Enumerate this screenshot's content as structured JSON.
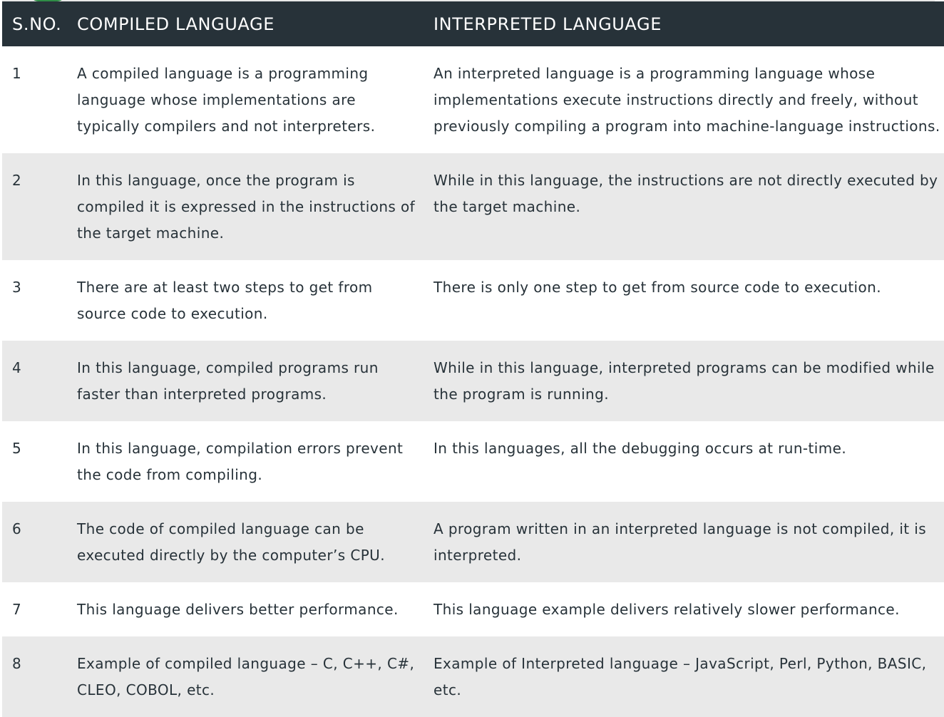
{
  "table": {
    "headers": {
      "sno": "S.NO.",
      "compiled": "COMPILED LANGUAGE",
      "interpreted": "INTERPRETED LANGUAGE"
    },
    "rows": [
      {
        "sno": "1",
        "compiled": "A compiled language is a programming language whose implementations are typically compilers and not interpreters.",
        "interpreted": "An interpreted language is a programming language whose implementations execute instructions directly and freely, without previously compiling a program into machine-language instructions."
      },
      {
        "sno": "2",
        "compiled": "In this language, once the program is compiled it is expressed in the instructions of the target machine.",
        "interpreted": "While in this language, the instructions are not directly executed by the target machine."
      },
      {
        "sno": "3",
        "compiled": "There are at least two steps to get from source code to execution.",
        "interpreted": "There is only one step to get from source code to execution."
      },
      {
        "sno": "4",
        "compiled": "In this language, compiled programs run faster than interpreted programs.",
        "interpreted": "While in this language, interpreted programs can be modified while the program is running."
      },
      {
        "sno": "5",
        "compiled": "In this language, compilation errors prevent the code from compiling.",
        "interpreted": "In this languages, all the debugging occurs at run-time."
      },
      {
        "sno": "6",
        "compiled": "The code of compiled language can be executed directly by the computer’s CPU.",
        "interpreted": "A program written in an interpreted language is not compiled, it is interpreted."
      },
      {
        "sno": "7",
        "compiled": "This language delivers better performance.",
        "interpreted": "This language example delivers relatively slower performance."
      },
      {
        "sno": "8",
        "compiled": "Example of compiled language – C, C++, C#, CLEO, COBOL, etc.",
        "interpreted": "Example of Interpreted language – JavaScript, Perl, Python, BASIC, etc."
      }
    ]
  },
  "colors": {
    "header_bg": "#273239",
    "header_text": "#ffffff",
    "row_alt_bg": "#e9e9e9",
    "body_text": "#273239",
    "accent": "#2f8d46"
  }
}
